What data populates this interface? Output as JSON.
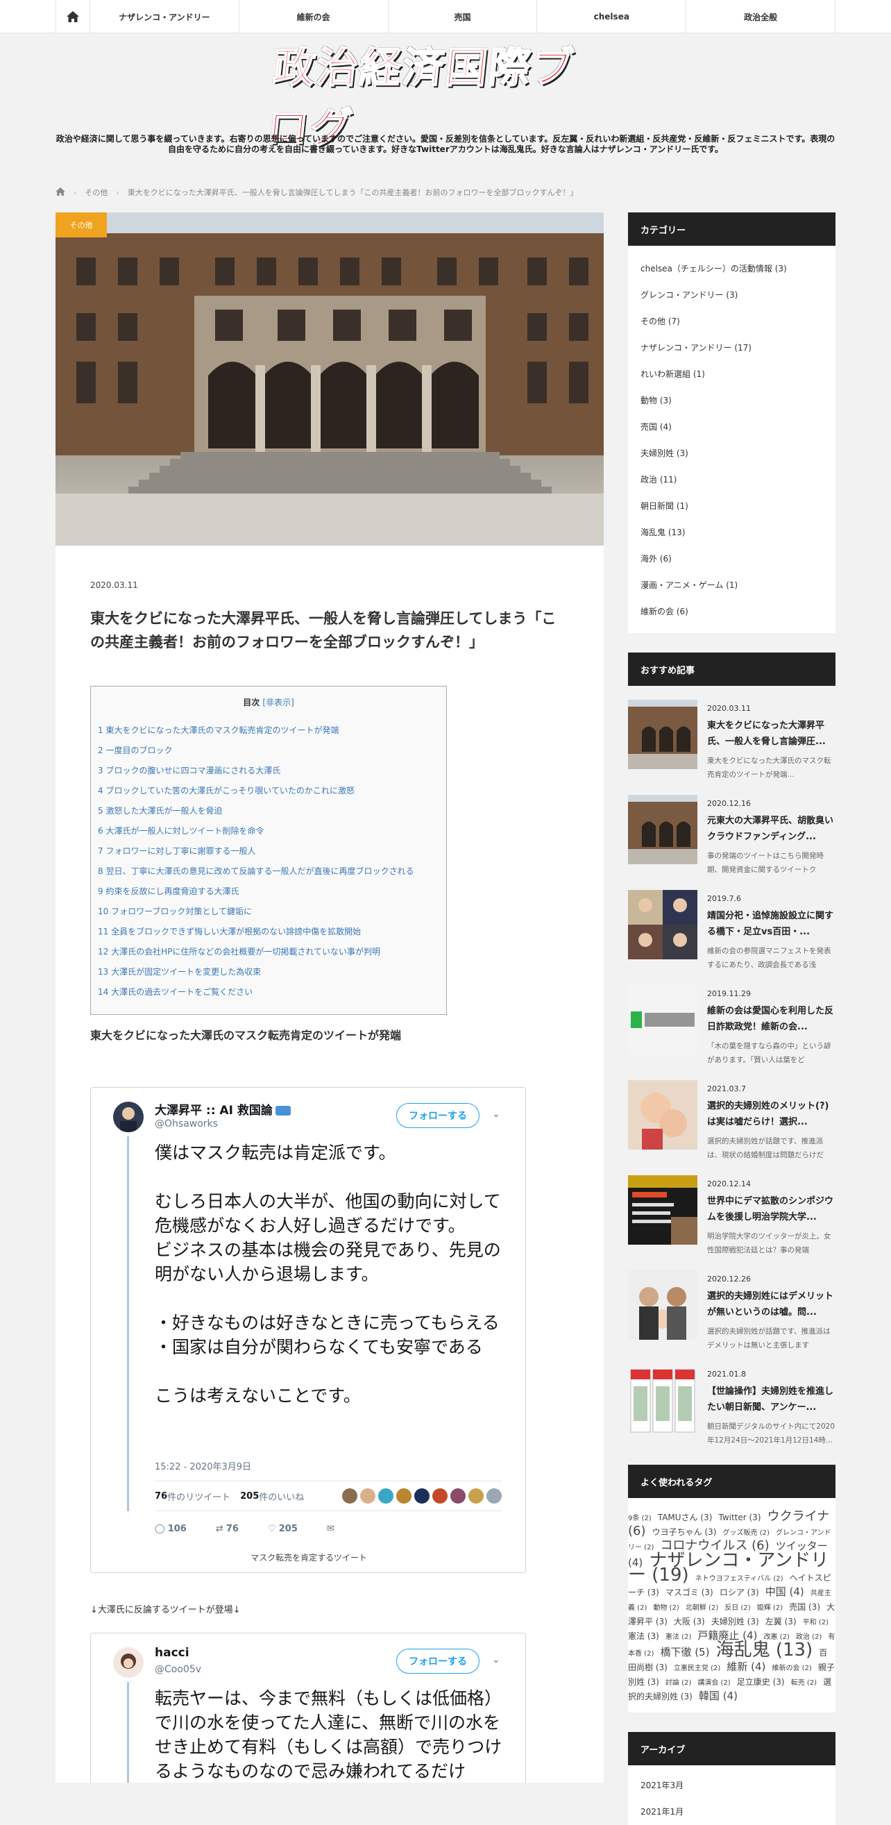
{
  "nav": {
    "items": [
      "ナザレンコ・アンドリー",
      "維新の会",
      "売国",
      "chelsea",
      "政治全般"
    ]
  },
  "header": {
    "logo_text": "政治経済国際ブログ",
    "tagline": "政治や経済に関して思う事を綴っていきます。右寄りの思想に偏っていますのでご注意ください。愛国・反差別を信条としています。反左翼・反れいわ新選組・反共産党・反維新・反フェミニストです。表現の自由を守るために自分の考えを自由に書き綴っていきます。好きなTwitterアカウントは海乱鬼氏。好きな言論人はナザレンコ・アンドリー氏です。"
  },
  "breadcrumb": {
    "category": "その他",
    "current": "東大をクビになった大澤昇平氏、一般人を脅し言論弾圧してしまう「この共産主義者！お前のフォロワーを全部ブロックすんぞ！」"
  },
  "article": {
    "category_tag": "その他",
    "date": "2020.03.11",
    "title": "東大をクビになった大澤昇平氏、一般人を脅し言論弾圧してしまう「この共産主義者！お前のフォロワーを全部ブロックすんぞ！」",
    "toc": {
      "label": "目次",
      "toggle": "[非表示]",
      "items": [
        "1 東大をクビになった大澤氏のマスク転売肯定のツイートが発端",
        "2 一度目のブロック",
        "3 ブロックの腹いせに四コマ漫画にされる大澤氏",
        "4 ブロックしていた筈の大澤氏がこっそり覗いていたのかこれに激怒",
        "5 激怒した大澤氏が一般人を脅迫",
        "6 大澤氏が一般人に対しツイート削除を命令",
        "7 フォロワーに対し丁寧に謝罪する一般人",
        "8 翌日、丁寧に大澤氏の意見に改めて反論する一般人だが直後に再度ブロックされる",
        "9 約束を反故にし再度脅迫する大澤氏",
        "10 フォロワーブロック対策として鍵垢に",
        "11 全員をブロックできず悔しい大澤が根拠のない誹謗中傷を拡散開始",
        "12 大澤氏の会社HPに住所などの会社概要が一切掲載されていない事が判明",
        "13 大澤氏が固定ツイートを変更した為収束",
        "14 大澤氏の過去ツイートをご覧ください"
      ]
    },
    "section1_heading": "東大をクビになった大澤氏のマスク転売肯定のツイートが発端",
    "tweet1": {
      "name": "大澤昇平 :: AI 救国論",
      "handle": "@Ohsaworks",
      "follow": "フォローする",
      "text": "僕はマスク転売は肯定派です。\n\nむしろ日本人の大半が、他国の動向に対して危機感がなくお人好し過ぎるだけです。\nビジネスの基本は機会の発見であり、先見の明がない人から退場します。\n\n・好きなものは好きなときに売ってもらえる\n・国家は自分が関わらなくても安寧である\n\nこうは考えないことです。",
      "time": "15:22 - 2020年3月9日",
      "retweets": "76",
      "retweets_label": "件のリツイート",
      "likes": "205",
      "likes_label": "件のいいね",
      "reply_count": "106",
      "rt_count": "76",
      "like_count": "205",
      "caption": "マスク転売を肯定するツイート"
    },
    "between_text": "↓大澤氏に反論するツイートが登場↓",
    "tweet2": {
      "name": "hacci",
      "handle": "@Coo05v",
      "follow": "フォローする",
      "text": "転売ヤーは、今まで無料（もしくは低価格）で川の水を使ってた人達に、無断で川の水をせき止めて有料（もしくは高額）で売りつけるようなものなので忌み嫌われてるだけ"
    }
  },
  "sidebar": {
    "categories_title": "カテゴリー",
    "categories": [
      "chelsea（チェルシー）の活動情報 (3)",
      "グレンコ・アンドリー (3)",
      "その他 (7)",
      "ナザレンコ・アンドリー (17)",
      "れいわ新選組 (1)",
      "動物 (3)",
      "売国 (4)",
      "夫婦別姓 (3)",
      "政治 (11)",
      "朝日新聞 (1)",
      "海乱鬼 (13)",
      "海外 (6)",
      "漫画・アニメ・ゲーム (1)",
      "維新の会 (6)"
    ],
    "recommended_title": "おすすめ記事",
    "recommended": [
      {
        "date": "2020.03.11",
        "title": "東大をクビになった大澤昇平氏、一般人を脅し言論弾圧...",
        "excerpt": "東大をクビになった大澤氏のマスク転売肯定のツイートが発端..."
      },
      {
        "date": "2020.12.16",
        "title": "元東大の大澤昇平氏、胡散臭いクラウドファンディング...",
        "excerpt": "事の発端のツイートはこちら開発時期、開発資金に関するツイートク"
      },
      {
        "date": "2019.7.6",
        "title": "靖国分祀・追悼施設設立に関する橋下・足立vs百田・...",
        "excerpt": "維新の会の参院選マニフェストを発表するにあたり、政調会長である浅"
      },
      {
        "date": "2019.11.29",
        "title": "維新の会は愛国心を利用した反日詐欺政党！維新の会...",
        "excerpt": "「木の葉を隠すなら森の中」という諺があります。「賢い人は葉をど"
      },
      {
        "date": "2021.03.7",
        "title": "選択的夫婦別姓のメリット(?)は実は嘘だらけ！選択...",
        "excerpt": "選択的夫婦別姓が話題です、推進派は、現状の結婚制度は問題だらけだ"
      },
      {
        "date": "2020.12.14",
        "title": "世界中にデマ拡散のシンポジウムを後援し明治学院大学...",
        "excerpt": "明治学院大学のツイッターが炎上。女性国際戦犯法廷とは？事の発端"
      },
      {
        "date": "2020.12.26",
        "title": "選択的夫婦別姓にはデメリットが無いというのは嘘。問...",
        "excerpt": "選択的夫婦別姓が話題です、推進派はデメリットは無いと主張します"
      },
      {
        "date": "2021.01.8",
        "title": "【世論操作】夫婦別姓を推進したい朝日新聞、アンケー...",
        "excerpt": "朝日新聞デジタルのサイト内にて2020年12月24日～2021年1月12日14時..."
      }
    ],
    "tags_title": "よく使われるタグ",
    "tags": [
      "9条 (2)",
      "TAMUさん (3)",
      "Twitter (3)",
      "ウクライナ (6)",
      "ウヨ子ちゃん (3)",
      "グッズ販売 (2)",
      "グレンコ・アンドリー (2)",
      "コロナウイルス (6)",
      "ツイッター (4)",
      "ナザレンコ・アンドリー (19)",
      "ネトウヨフェスティバル (2)",
      "ヘイトスピーチ (3)",
      "マスゴミ (3)",
      "ロシア (3)",
      "中国 (4)",
      "共産主義 (2)",
      "動物 (2)",
      "北朝鮮 (2)",
      "反日 (2)",
      "姫輝 (2)",
      "売国 (3)",
      "大澤昇平 (3)",
      "大阪 (3)",
      "夫婦別姓 (3)",
      "左翼 (3)",
      "平和 (2)",
      "憲法 (3)",
      "憲法 (2)",
      "戸籍廃止 (4)",
      "改憲 (2)",
      "政治 (2)",
      "有本香 (2)",
      "橋下徹 (5)",
      "海乱鬼 (13)",
      "百田尚樹 (3)",
      "立憲民主党 (2)",
      "維新 (4)",
      "維新の会 (2)",
      "親子別姓 (3)",
      "討論 (2)",
      "講演会 (2)",
      "足立康史 (3)",
      "転売 (2)",
      "選択的夫婦別姓 (3)",
      "韓国 (4)"
    ],
    "archive_title": "アーカイブ",
    "archive": [
      "2021年3月",
      "2021年1月"
    ]
  },
  "colors": {
    "accent": "#f0a31e",
    "link": "#3b78b8",
    "widget_header": "#222222",
    "twitter_blue": "#1da1f2",
    "logo_red": "#e8102a"
  }
}
